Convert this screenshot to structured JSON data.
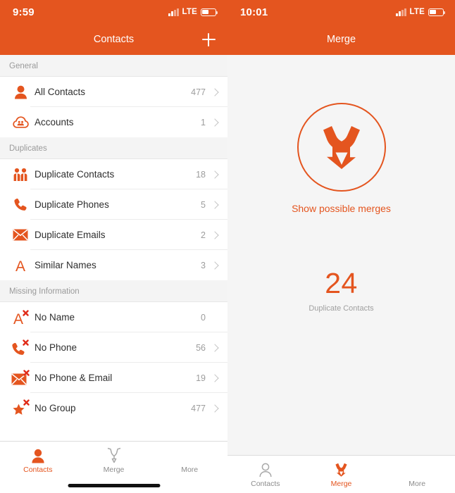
{
  "theme": {
    "accent": "#E4551F",
    "danger": "#E02B18",
    "muted": "#9D9D9D",
    "bg": "#F5F5F5"
  },
  "left_screen": {
    "status": {
      "time": "9:59",
      "network": "LTE"
    },
    "nav": {
      "title": "Contacts",
      "add_button": "+"
    },
    "sections": [
      {
        "header": "General",
        "rows": [
          {
            "icon": "person-filled-icon",
            "label": "All Contacts",
            "count": "477",
            "chevron": true
          },
          {
            "icon": "cloud-accounts-icon",
            "label": "Accounts",
            "count": "1",
            "chevron": true
          }
        ]
      },
      {
        "header": "Duplicates",
        "rows": [
          {
            "icon": "two-people-icon",
            "label": "Duplicate Contacts",
            "count": "18",
            "chevron": true
          },
          {
            "icon": "phone-icon",
            "label": "Duplicate Phones",
            "count": "5",
            "chevron": true
          },
          {
            "icon": "envelope-icon",
            "label": "Duplicate Emails",
            "count": "2",
            "chevron": true
          },
          {
            "icon": "letter-a-icon",
            "label": "Similar Names",
            "count": "3",
            "chevron": true
          }
        ]
      },
      {
        "header": "Missing Information",
        "rows": [
          {
            "icon": "letter-a-x-icon",
            "label": "No Name",
            "count": "0",
            "chevron": false
          },
          {
            "icon": "phone-x-icon",
            "label": "No Phone",
            "count": "56",
            "chevron": true
          },
          {
            "icon": "envelope-x-icon",
            "label": "No Phone & Email",
            "count": "19",
            "chevron": true
          },
          {
            "icon": "star-x-icon",
            "label": "No Group",
            "count": "477",
            "chevron": true
          }
        ]
      }
    ],
    "tabs": [
      {
        "icon": "person-filled-icon",
        "label": "Contacts",
        "active": true
      },
      {
        "icon": "merge-arrow-outline-icon",
        "label": "Merge",
        "active": false
      },
      {
        "icon": "hamburger-icon",
        "label": "More",
        "active": false
      }
    ]
  },
  "right_screen": {
    "status": {
      "time": "10:01",
      "network": "LTE"
    },
    "nav": {
      "title": "Merge"
    },
    "main": {
      "merge_icon": "merge-arrow-filled-icon",
      "action_label": "Show possible merges",
      "count": "24",
      "count_label": "Duplicate Contacts"
    },
    "tabs": [
      {
        "icon": "person-outline-icon",
        "label": "Contacts",
        "active": false
      },
      {
        "icon": "merge-arrow-filled-icon",
        "label": "Merge",
        "active": true
      },
      {
        "icon": "hamburger-icon",
        "label": "More",
        "active": false
      }
    ]
  }
}
